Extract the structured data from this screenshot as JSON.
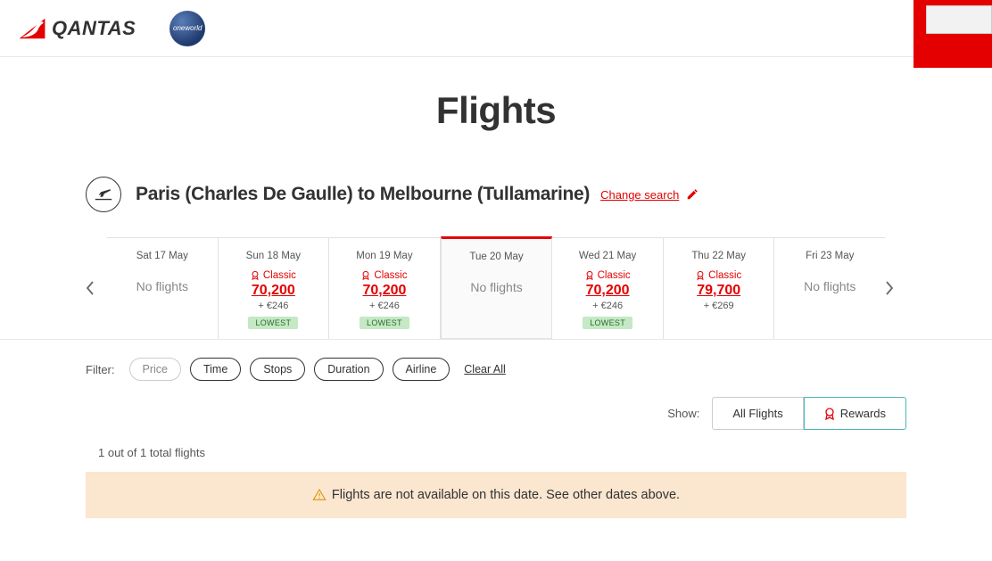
{
  "header": {
    "brand": "QANTAS",
    "alliance": "oneworld"
  },
  "page_title": "Flights",
  "route": {
    "text": "Paris (Charles De Gaulle) to Melbourne (Tullamarine)",
    "change_label": "Change search"
  },
  "date_tabs": [
    {
      "date": "Sat 17 May",
      "no_flights": "No flights"
    },
    {
      "date": "Sun 18 May",
      "classic": "Classic",
      "points": "70,200",
      "surcharge": "+ €246",
      "lowest": "LOWEST"
    },
    {
      "date": "Mon 19 May",
      "classic": "Classic",
      "points": "70,200",
      "surcharge": "+ €246",
      "lowest": "LOWEST"
    },
    {
      "date": "Tue 20 May",
      "no_flights": "No flights",
      "selected": true
    },
    {
      "date": "Wed 21 May",
      "classic": "Classic",
      "points": "70,200",
      "surcharge": "+ €246",
      "lowest": "LOWEST"
    },
    {
      "date": "Thu 22 May",
      "classic": "Classic",
      "points": "79,700",
      "surcharge": "+ €269"
    },
    {
      "date": "Fri 23 May",
      "no_flights": "No flights"
    }
  ],
  "filters": {
    "label": "Filter:",
    "pills": [
      "Price",
      "Time",
      "Stops",
      "Duration",
      "Airline"
    ],
    "clear": "Clear All"
  },
  "show": {
    "label": "Show:",
    "all": "All Flights",
    "rewards": "Rewards"
  },
  "count_text": "1 out of 1 total flights",
  "warning_text": "Flights are not available on this date. See other dates above."
}
